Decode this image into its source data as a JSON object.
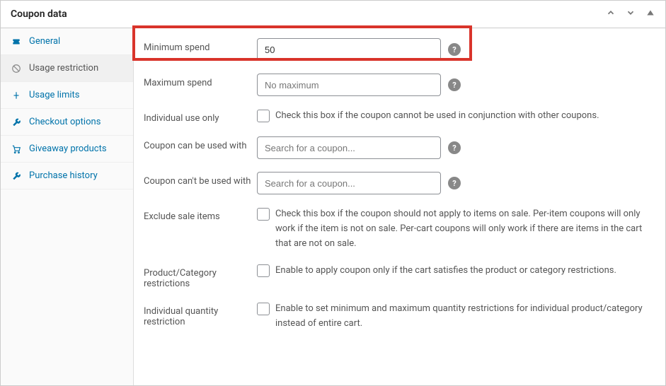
{
  "panel": {
    "title": "Coupon data"
  },
  "sidebar": {
    "items": [
      {
        "label": "General"
      },
      {
        "label": "Usage restriction"
      },
      {
        "label": "Usage limits"
      },
      {
        "label": "Checkout options"
      },
      {
        "label": "Giveaway products"
      },
      {
        "label": "Purchase history"
      }
    ]
  },
  "form": {
    "min_spend": {
      "label": "Minimum spend",
      "value": "50"
    },
    "max_spend": {
      "label": "Maximum spend",
      "placeholder": "No maximum"
    },
    "individual_use": {
      "label": "Individual use only",
      "desc": "Check this box if the coupon cannot be used in conjunction with other coupons."
    },
    "used_with": {
      "label": "Coupon can be used with",
      "placeholder": "Search for a coupon..."
    },
    "not_used_with": {
      "label": "Coupon can't be used with",
      "placeholder": "Search for a coupon..."
    },
    "exclude_sale": {
      "label": "Exclude sale items",
      "desc": "Check this box if the coupon should not apply to items on sale. Per-item coupons will only work if the item is not on sale. Per-cart coupons will only work if there are items in the cart that are not on sale."
    },
    "prod_cat": {
      "label": "Product/Category restrictions",
      "desc": "Enable to apply coupon only if the cart satisfies the product or category restrictions."
    },
    "ind_qty": {
      "label": "Individual quantity restriction",
      "desc": "Enable to set minimum and maximum quantity restrictions for individual product/category instead of entire cart."
    }
  }
}
